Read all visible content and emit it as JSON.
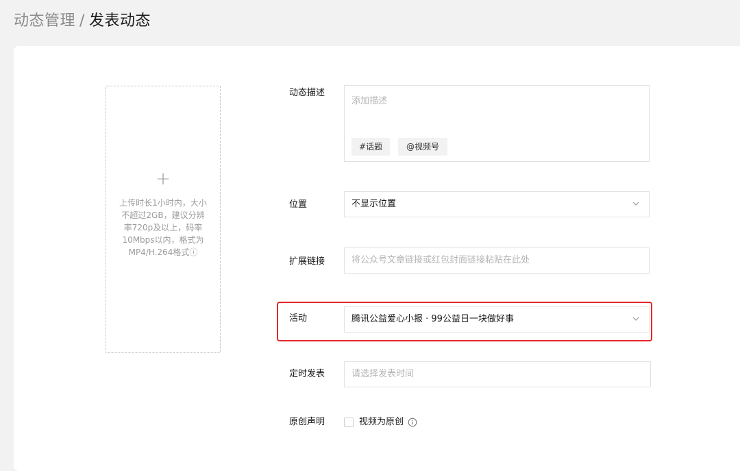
{
  "breadcrumb": {
    "parent": "动态管理",
    "separator": "/",
    "current": "发表动态"
  },
  "upload": {
    "plus": "+",
    "hint": "上传时长1小时内，大小不超过2GB，建议分辨率720p及以上，码率10Mbps以内，格式为MP4/H.264格式ⓘ"
  },
  "form": {
    "description": {
      "label": "动态描述",
      "placeholder": "添加描述",
      "chips": [
        "#话题",
        "@视频号"
      ]
    },
    "location": {
      "label": "位置",
      "value": "不显示位置",
      "icon": "chevron-down-icon"
    },
    "link": {
      "label": "扩展链接",
      "placeholder": "将公众号文章链接或红包封面链接粘贴在此处"
    },
    "activity": {
      "label": "活动",
      "value": "腾讯公益爱心小报 · 99公益日一块做好事",
      "icon": "chevron-down-icon",
      "highlight_color": "#e3262a"
    },
    "schedule": {
      "label": "定时发表",
      "placeholder": "请选择发表时间"
    },
    "original": {
      "label": "原创声明",
      "checkbox_label": "视频为原创",
      "checked": false,
      "icon": "info-icon"
    }
  }
}
